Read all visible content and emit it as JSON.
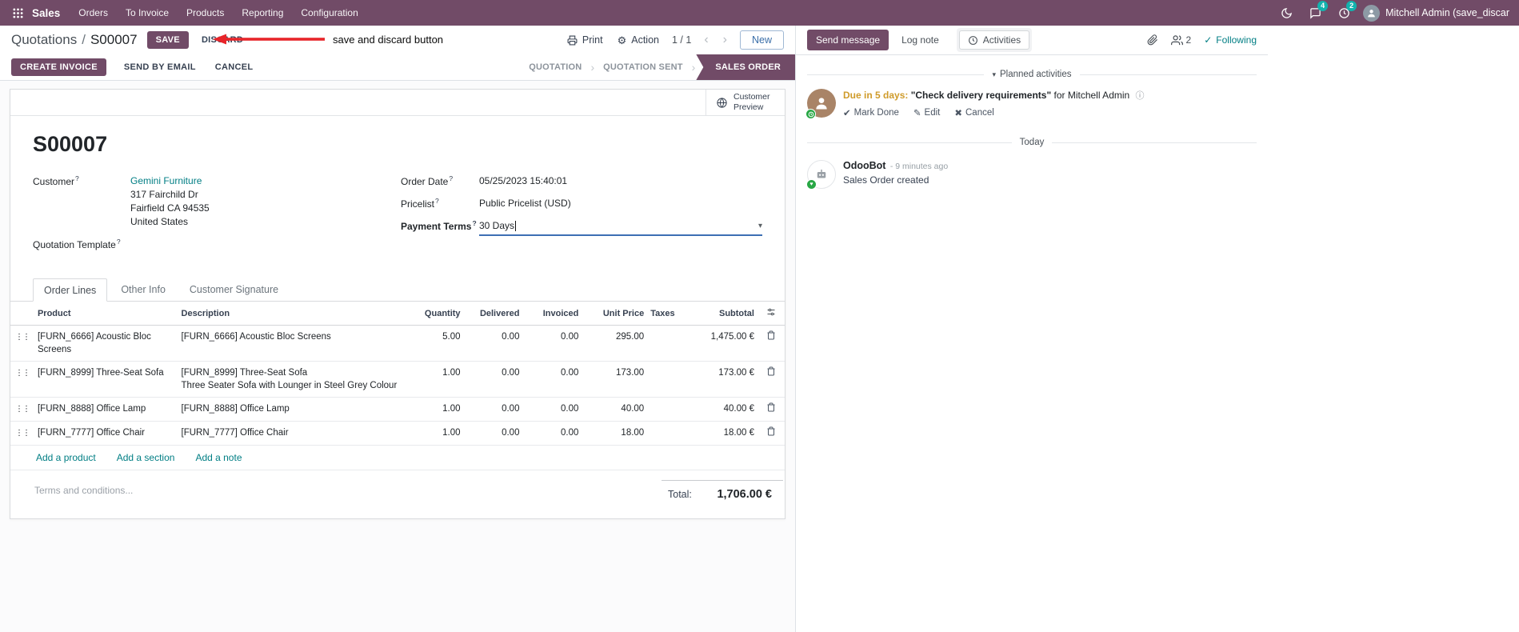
{
  "nav": {
    "brand": "Sales",
    "menus": [
      "Orders",
      "To Invoice",
      "Products",
      "Reporting",
      "Configuration"
    ],
    "messages_badge": "4",
    "activities_badge": "2",
    "user": "Mitchell Admin (save_discar"
  },
  "breadcrumb": {
    "parent": "Quotations",
    "separator": "/",
    "current": "S00007",
    "save_label": "SAVE",
    "discard_label": "DISCARD"
  },
  "annotation": {
    "text": "save and discard button"
  },
  "header_actions": {
    "print": "Print",
    "action": "Action",
    "pager": "1 / 1",
    "new": "New"
  },
  "statusbar": {
    "buttons": [
      "CREATE INVOICE",
      "SEND BY EMAIL",
      "CANCEL"
    ],
    "states": [
      {
        "label": "QUOTATION",
        "active": false
      },
      {
        "label": "QUOTATION SENT",
        "active": false
      },
      {
        "label": "SALES ORDER",
        "active": true
      }
    ]
  },
  "sheet": {
    "help": "?",
    "customer_preview": "Customer Preview",
    "title": "S00007",
    "fields": {
      "customer_label": "Customer",
      "customer_value": "Gemini Furniture",
      "address": [
        "317 Fairchild Dr",
        "Fairfield CA 94535",
        "United States"
      ],
      "quotation_template_label": "Quotation Template",
      "order_date_label": "Order Date",
      "order_date_value": "05/25/2023 15:40:01",
      "pricelist_label": "Pricelist",
      "pricelist_value": "Public Pricelist (USD)",
      "payment_terms_label": "Payment Terms",
      "payment_terms_value": "30 Days"
    },
    "tabs": [
      {
        "label": "Order Lines",
        "active": true
      },
      {
        "label": "Other Info",
        "active": false
      },
      {
        "label": "Customer Signature",
        "active": false
      }
    ],
    "table": {
      "headers": [
        "Product",
        "Description",
        "Quantity",
        "Delivered",
        "Invoiced",
        "Unit Price",
        "Taxes",
        "Subtotal"
      ],
      "rows": [
        {
          "product": "[FURN_6666] Acoustic Bloc Screens",
          "description": "[FURN_6666] Acoustic Bloc Screens",
          "description2": "",
          "quantity": "5.00",
          "delivered": "0.00",
          "invoiced": "0.00",
          "unit_price": "295.00",
          "taxes": "",
          "subtotal": "1,475.00 €",
          "modified": false
        },
        {
          "product": "[FURN_8999] Three-Seat Sofa",
          "description": "[FURN_8999] Three-Seat Sofa",
          "description2": "Three Seater Sofa with Lounger in Steel Grey Colour",
          "quantity": "1.00",
          "delivered": "0.00",
          "invoiced": "0.00",
          "unit_price": "173.00",
          "taxes": "",
          "subtotal": "173.00 €",
          "modified": true
        },
        {
          "product": "[FURN_8888] Office Lamp",
          "description": "[FURN_8888] Office Lamp",
          "description2": "",
          "quantity": "1.00",
          "delivered": "0.00",
          "invoiced": "0.00",
          "unit_price": "40.00",
          "taxes": "",
          "subtotal": "40.00 €",
          "modified": false
        },
        {
          "product": "[FURN_7777] Office Chair",
          "description": "[FURN_7777] Office Chair",
          "description2": "",
          "quantity": "1.00",
          "delivered": "0.00",
          "invoiced": "0.00",
          "unit_price": "18.00",
          "taxes": "",
          "subtotal": "18.00 €",
          "modified": false
        }
      ],
      "footer_links": [
        "Add a product",
        "Add a section",
        "Add a note"
      ]
    },
    "terms_placeholder": "Terms and conditions...",
    "total_label": "Total:",
    "total_value": "1,706.00 €"
  },
  "chatter": {
    "send_message": "Send message",
    "log_note": "Log note",
    "activities_tab": "Activities",
    "followers_count": "2",
    "following": "Following",
    "planned_header": "Planned activities",
    "activity": {
      "due": "Due in 5 days:",
      "summary": "\"Check delivery requirements\"",
      "for_text": "for Mitchell Admin",
      "mark_done": "Mark Done",
      "edit": "Edit",
      "cancel": "Cancel"
    },
    "date_divider": "Today",
    "message": {
      "author": "OdooBot",
      "time": "- 9 minutes ago",
      "body": "Sales Order created"
    }
  },
  "icons": {
    "gear": "⚙",
    "chevron_left": "‹",
    "chevron_right": "›",
    "statusbar_chevron": "›",
    "caret_down": "▾",
    "check": "✔",
    "pencil": "✎",
    "cross": "✖",
    "info": "ⓘ",
    "following_check": "✓",
    "drag": "⋮⋮",
    "heart": "♥"
  },
  "colors": {
    "primary": "#714B67",
    "link": "#017E84",
    "modified": "#2E7BBF",
    "due": "#CF9B2A",
    "badge": "#12B3AE",
    "focus": "#3D6FB4",
    "arrow": "#E8252A"
  }
}
